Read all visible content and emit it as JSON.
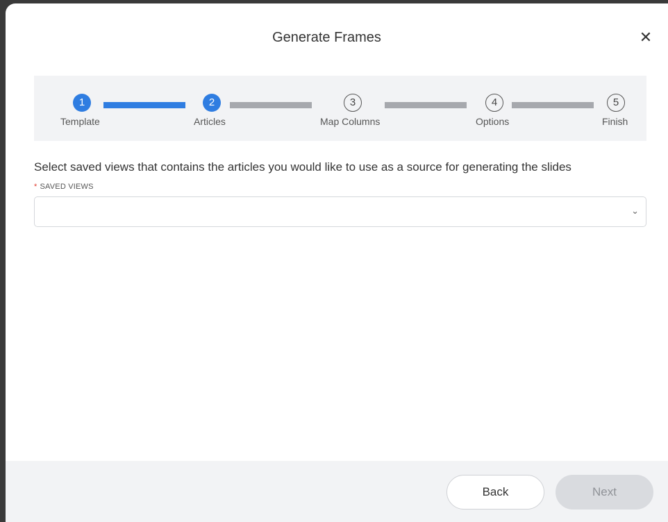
{
  "dialog": {
    "title": "Generate Frames",
    "close_symbol": "✕"
  },
  "stepper": {
    "steps": [
      {
        "number": "1",
        "label": "Template",
        "state": "completed"
      },
      {
        "number": "2",
        "label": "Articles",
        "state": "current"
      },
      {
        "number": "3",
        "label": "Map Columns",
        "state": "upcoming"
      },
      {
        "number": "4",
        "label": "Options",
        "state": "upcoming"
      },
      {
        "number": "5",
        "label": "Finish",
        "state": "upcoming"
      }
    ],
    "active_color": "#2f7de1",
    "inactive_color": "#a6a8ad"
  },
  "content": {
    "instruction": "Select saved views that contains the articles you would like to use as a source for generating the slides",
    "saved_views": {
      "required_marker": "*",
      "label": "SAVED VIEWS",
      "value": "",
      "chevron": "⌄"
    }
  },
  "footer": {
    "back_label": "Back",
    "next_label": "Next"
  }
}
